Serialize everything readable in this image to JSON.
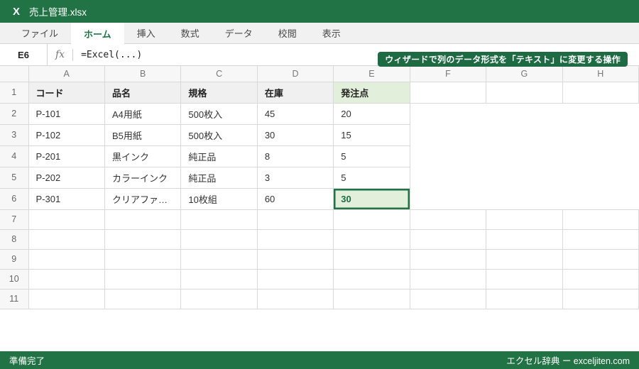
{
  "window": {
    "logo": "X",
    "title": "売上管理.xlsx"
  },
  "menu": {
    "items": [
      {
        "label": "ファイル",
        "active": false
      },
      {
        "label": "ホーム",
        "active": true
      },
      {
        "label": "挿入",
        "active": false
      },
      {
        "label": "数式",
        "active": false
      },
      {
        "label": "データ",
        "active": false
      },
      {
        "label": "校閲",
        "active": false
      },
      {
        "label": "表示",
        "active": false
      }
    ]
  },
  "formula_bar": {
    "name_box": "E6",
    "fx_label": "fx",
    "formula": "=Excel(...)"
  },
  "tooltip": {
    "text": "ウィザードで列のデータ形式を「テキスト」に変更する操作"
  },
  "grid": {
    "column_letters": [
      "A",
      "B",
      "C",
      "D",
      "E",
      "F",
      "G",
      "H"
    ],
    "row_count": 11,
    "header_row": {
      "row": 1,
      "values": [
        "コード",
        "品名",
        "規格",
        "在庫",
        "発注点"
      ],
      "highlight_column": "E"
    },
    "data_rows": [
      {
        "row": 2,
        "values": [
          "P-101",
          "A4用紙",
          "500枚入",
          "45",
          "20"
        ]
      },
      {
        "row": 3,
        "values": [
          "P-102",
          "B5用紙",
          "500枚入",
          "30",
          "15"
        ]
      },
      {
        "row": 4,
        "values": [
          "P-201",
          "黒インク",
          "純正品",
          "8",
          "5"
        ]
      },
      {
        "row": 5,
        "values": [
          "P-202",
          "カラーインク",
          "純正品",
          "3",
          "5"
        ]
      },
      {
        "row": 6,
        "values": [
          "P-301",
          "クリアファ…",
          "10枚組",
          "60",
          "30"
        ]
      }
    ],
    "selected_cell": {
      "ref": "E6",
      "column": "E",
      "row": 6,
      "value": "30"
    }
  },
  "status_bar": {
    "left": "準備完了",
    "right": "エクセル辞典 ー exceljiten.com"
  },
  "colors": {
    "excel_green": "#217346",
    "tooltip_green": "#1e6b43",
    "selection_fill": "#e2efda",
    "header_fill": "#f0f0f0",
    "grid_line": "#d9d9d9"
  }
}
